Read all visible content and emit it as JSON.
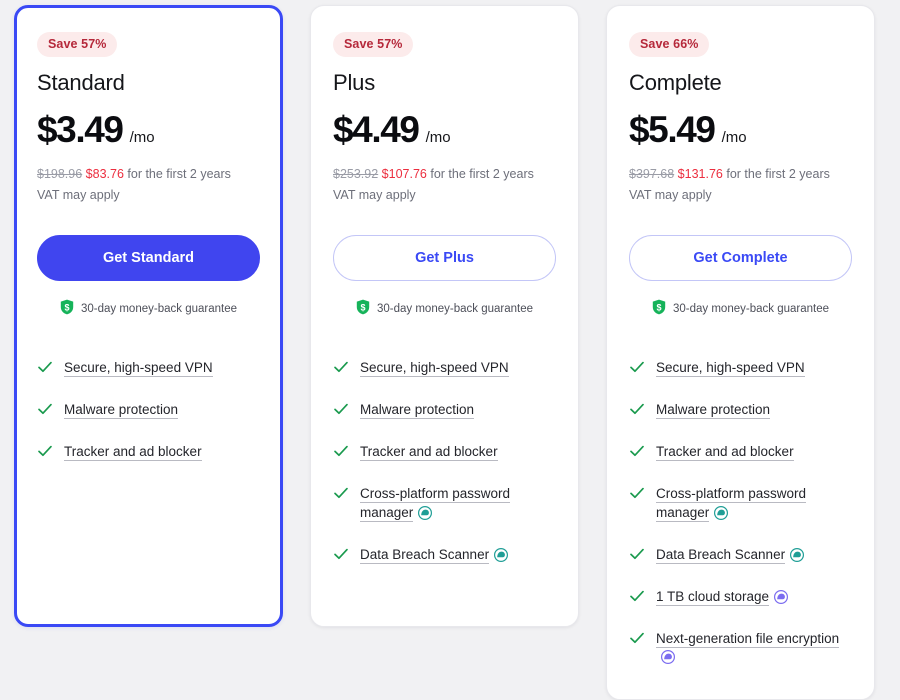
{
  "colors": {
    "page_background": "#f1f1f3",
    "card_background": "#ffffff",
    "selected_border": "#3a49f5",
    "primary_button": "#4045ef",
    "outline_button_text": "#3a49f5",
    "save_badge_background": "#fcebeb",
    "save_badge_text": "#b5283a",
    "old_price": "#9a9ca6",
    "new_price": "#ec2e3f",
    "check_green": "#1a9a4e",
    "shield_green": "#16b35a",
    "badge_teal": "#1f9e96",
    "badge_purple": "#7b6cf0"
  },
  "plans": [
    {
      "id": "standard",
      "save_badge": "Save 57%",
      "name": "Standard",
      "price": "$3.49",
      "period": "/mo",
      "old_price": "$198.96",
      "new_price": "$83.76",
      "price_suffix": "for the first 2 years",
      "vat_note": "VAT may apply",
      "cta_label": "Get Standard",
      "cta_style": "primary",
      "selected": true,
      "guarantee": "30-day money-back guarantee",
      "features": [
        {
          "label": "Secure, high-speed VPN",
          "badge": "none"
        },
        {
          "label": "Malware protection",
          "badge": "none"
        },
        {
          "label": "Tracker and ad blocker",
          "badge": "none"
        }
      ]
    },
    {
      "id": "plus",
      "save_badge": "Save 57%",
      "name": "Plus",
      "price": "$4.49",
      "period": "/mo",
      "old_price": "$253.92",
      "new_price": "$107.76",
      "price_suffix": "for the first 2 years",
      "vat_note": "VAT may apply",
      "cta_label": "Get Plus",
      "cta_style": "outline",
      "selected": false,
      "guarantee": "30-day money-back guarantee",
      "features": [
        {
          "label": "Secure, high-speed VPN",
          "badge": "none"
        },
        {
          "label": "Malware protection",
          "badge": "none"
        },
        {
          "label": "Tracker and ad blocker",
          "badge": "none"
        },
        {
          "label": "Cross-platform password manager",
          "badge": "teal"
        },
        {
          "label": "Data Breach Scanner",
          "badge": "teal"
        }
      ]
    },
    {
      "id": "complete",
      "save_badge": "Save 66%",
      "name": "Complete",
      "price": "$5.49",
      "period": "/mo",
      "old_price": "$397.68",
      "new_price": "$131.76",
      "price_suffix": "for the first 2 years",
      "vat_note": "VAT may apply",
      "cta_label": "Get Complete",
      "cta_style": "outline",
      "selected": false,
      "guarantee": "30-day money-back guarantee",
      "features": [
        {
          "label": "Secure, high-speed VPN",
          "badge": "none"
        },
        {
          "label": "Malware protection",
          "badge": "none"
        },
        {
          "label": "Tracker and ad blocker",
          "badge": "none"
        },
        {
          "label": "Cross-platform password manager",
          "badge": "teal"
        },
        {
          "label": "Data Breach Scanner",
          "badge": "teal"
        },
        {
          "label": "1 TB cloud storage",
          "badge": "purple"
        },
        {
          "label": "Next-generation file encryption",
          "badge": "purple"
        }
      ]
    }
  ]
}
